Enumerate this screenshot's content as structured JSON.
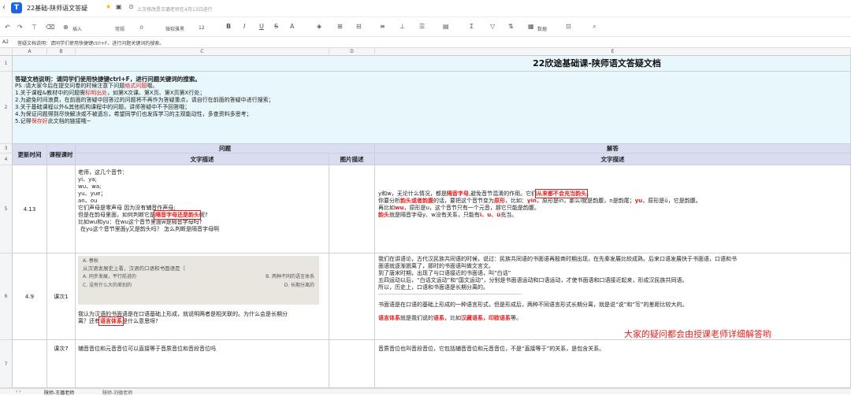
{
  "titlebar": {
    "doc_title": "22基础-陕师语文答疑",
    "save_status": "上次修改是王璐老师在4月13日进行"
  },
  "toolbar": {
    "insert_label": "插入",
    "format_label": "常规",
    "decimal_label": ".0",
    "font_label": "微软雅黑",
    "size_label": "12",
    "data_label": "数据"
  },
  "formulabar": {
    "cell_ref": "A2",
    "content": "答疑文档说明：请同学们使用快捷键ctrl+F，进行问题关键词的搜索。"
  },
  "columns": [
    "A",
    "B",
    "C",
    "D",
    "E"
  ],
  "rows": [
    "1",
    "2",
    "3",
    "4",
    "5",
    "6",
    "7"
  ],
  "sheet": {
    "main_title": "22欣途基础课-陕师语文答疑文档",
    "intro": {
      "heading": "答疑文档说明：请同学们使用快捷键ctrl+F，进行问题关键词的搜索。",
      "ps_a": "PS :请大家今后在提交问卷的时候注意下问题",
      "ps_b": "格式问题",
      "ps_c": "哦。",
      "l1_a": "1.关于课程&教材中的问题需",
      "l1_b": "标明出处",
      "l1_c": "，如第X次课、第X页、第X页第X行处；",
      "l2": "2.为避免时间浪费，在前面的答疑中回答过的问题将不再作为答疑重点，请自行在前面的答疑中进行搜索；",
      "l3": "3.关于基础课程以外&其他机构课程中的问题，讲师答疑中不予回答哦；",
      "l4": "4.为保证问题得到尽快解决或不被遗忘，希望同学们也发挥学习的主观能动性，多查资料多思考；",
      "l5_a": "5.记得",
      "l5_b": "保存好",
      "l5_c": "此文档的链接哦~"
    },
    "headers": {
      "update_time": "更新时间",
      "lesson": "课程课时",
      "question": "问题",
      "text_desc": "文字描述",
      "image_desc": "图片描述",
      "answer": "解答",
      "answer_text": "文字描述"
    },
    "row5": {
      "date": "4.13",
      "q_lines": [
        "老师，这几个音节：",
        "yi、ya;",
        "wu、wa;",
        "yu、yue；",
        "an、ou",
        "它们声母是零声母 因为没有辅音作声母;"
      ],
      "q_hl_a": "但是在韵母里面，如何判断它是",
      "q_hl_b": "隔音字母还是韵头",
      "q_hl_c": "呢?",
      "q_l7": "比如wu和yu：在wu这个音节里面w是隔音字母吗?",
      "q_l8": "在yu这个音节里面y又是韵头吗？ 怎么判断是隔音字母啊",
      "a_l1_a": "y和w，无论什么情况，都是",
      "a_l1_b": "隔音字母",
      "a_l1_c": ",避免音节混淆的作用。它们",
      "a_l1_d": "从来都不会充当韵头",
      "a_l1_e": "。",
      "a_l2_a": "你要分析",
      "a_l2_b": "韵头或者韵腹",
      "a_l2_c": "的话，要把这个音节变为",
      "a_l2_d": "原形",
      "a_l2_e": "，比如：",
      "a_l2_f": "yin",
      "a_l2_g": "，原形是in，那么i就是韵腹，n是韵尾；",
      "a_l2_h": "yu",
      "a_l2_i": "，原形是ü，它是韵腹。",
      "a_l3_a": "再比如",
      "a_l3_b": "wu",
      "a_l3_c": "，原形是u，这个音节只有一个元音，那它只能是韵腹。",
      "a_l4_a": "韵头",
      "a_l4_b": "就是隔音字母y、w没有关系，只能有",
      "a_l4_c": "i、u、ü",
      "a_l4_d": "充当。"
    },
    "row6": {
      "date": "4.9",
      "lesson": "课次1",
      "img_lines": [
        "A. 春秋",
        "从汉语发展史上看，汉语的口语和书面语是（",
        "A. 同步发展，平行前进的",
        "B. 两种不同的语言体系",
        "C. 没有什么大的差别的",
        "D. 长期分离的"
      ],
      "q_l1": "我认为汉语的书面语是在口语基础上形成，就说明两者是相关联的。为什么会是长期分",
      "q_l2_a": "离？还有",
      "q_l2_b": "语言体系",
      "q_l2_c": "是什么意思呀?",
      "a_lines": [
        "我们在讲语论，古代汉民族共同语的时候，说过：民族共同语的书面语再殷商时期出现，在先秦发展比较成熟。后来口语发展快于书面语，口语和书",
        "面语就逐渐脱离了，那时的书面语叫做文言文。",
        "到了唐宋时期，出现了与口语接近的书面语，叫“白话”",
        "五四运动以后，“白话文运动”和“国文运动”，分别是书面语运动和口语运动，才使书面语和口语接近起来，形成汉民族共同语。",
        "所以，历史上，口语和书面语是长期分离的。"
      ],
      "a_sep": "------------------------------------------------------------------------",
      "a_l6": "书面语是在口语的基础上形成的一种语言形式，但是形成后，两种不同语言形式长期分离，就是说“说”和“写”的差距比较大的。",
      "a_l7_a": "语言体系",
      "a_l7_b": "就是我们说的",
      "a_l7_c": "语系",
      "a_l7_d": "，比如",
      "a_l7_e": "汉藏语系，印欧语系",
      "a_l7_f": "等。",
      "overlay": "大家的疑问都会由授课老师详细解答哟"
    },
    "row7": {
      "lesson": "课次7",
      "question": "辅音音位和元音音位可以直接等于音质音位和音段音位吗",
      "answer": "音质音位也叫音段音位，它包括辅音音位和元音音位，不是“直接等于”的关系，是包含关系。"
    },
    "sheet_tab": "陕师-王璐老师",
    "sheet_tab2": "陕师-刘德老师"
  }
}
